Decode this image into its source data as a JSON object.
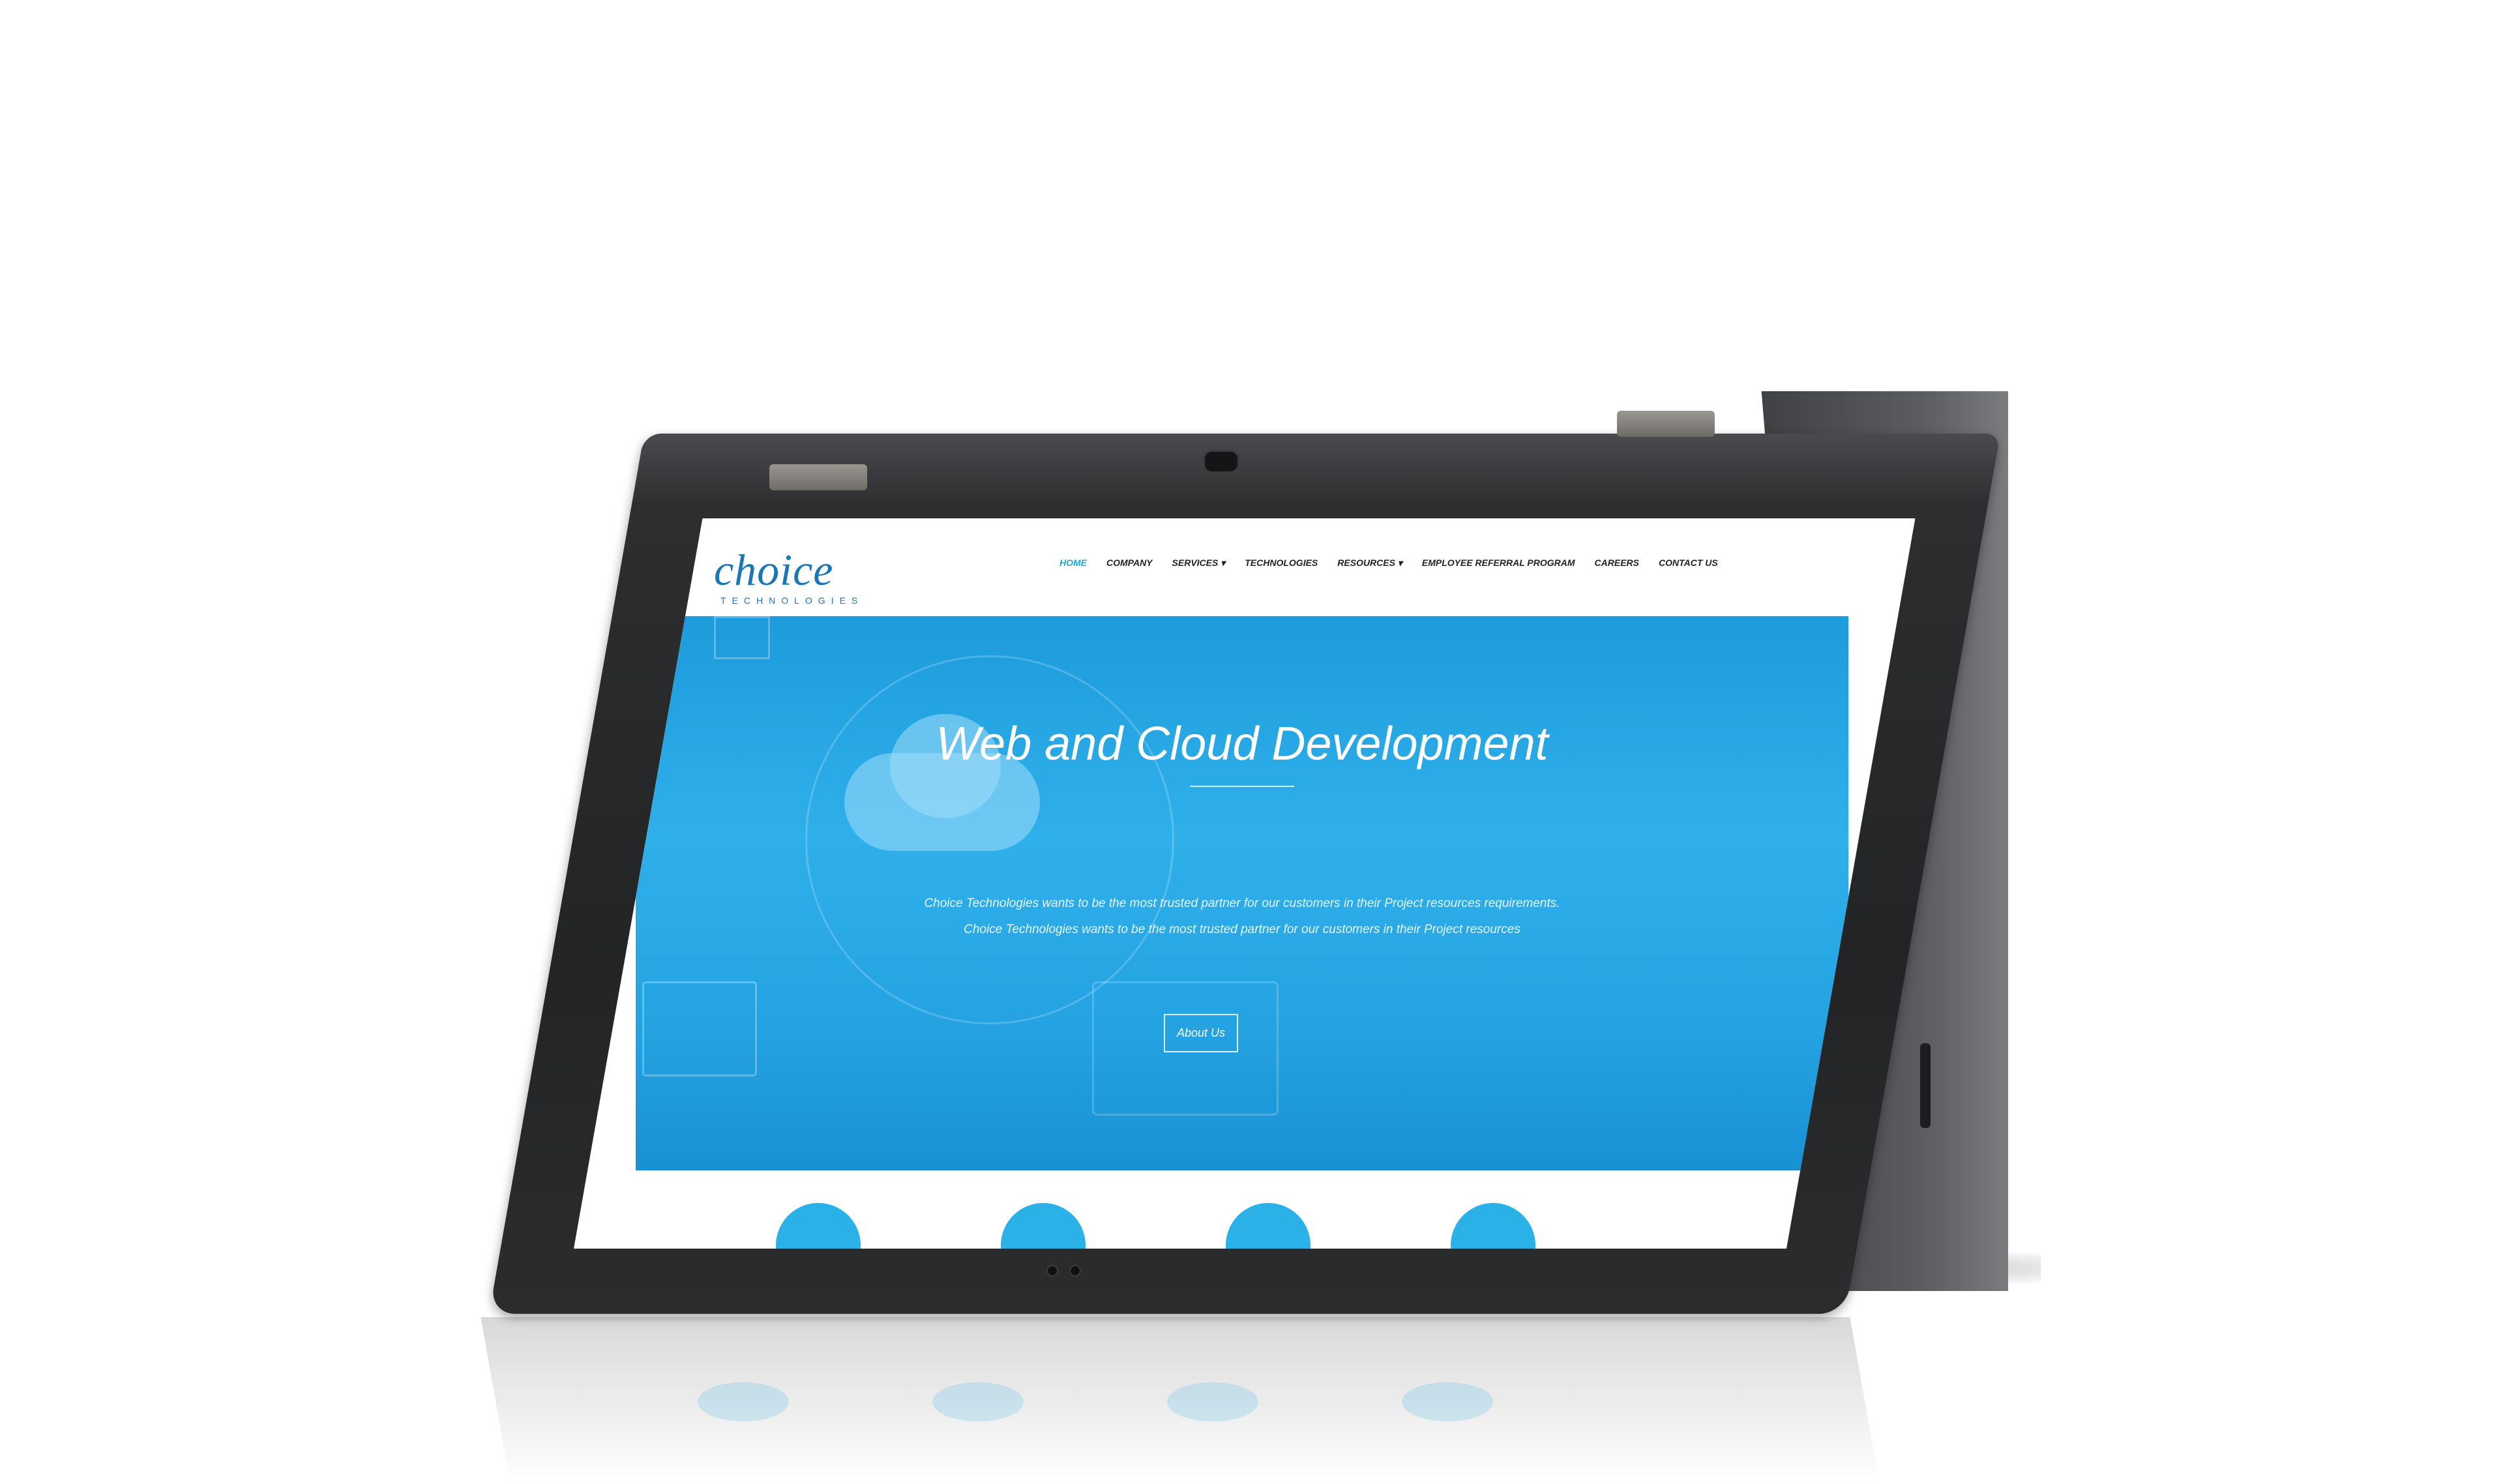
{
  "site": {
    "logo_text": "choice",
    "logo_subtext": "TECHNOLOGIES",
    "nav": [
      {
        "label": "HOME",
        "active": true
      },
      {
        "label": "COMPANY",
        "active": false
      },
      {
        "label": "SERVICES ▾",
        "active": false
      },
      {
        "label": "TECHNOLOGIES",
        "active": false
      },
      {
        "label": "RESOURCES ▾",
        "active": false
      },
      {
        "label": "EMPLOYEE REFERRAL PROGRAM",
        "active": false
      },
      {
        "label": "CAREERS",
        "active": false
      },
      {
        "label": "CONTACT US",
        "active": false
      }
    ]
  },
  "hero": {
    "title": "Web and Cloud Development",
    "desc_line1": "Choice Technologies wants to be the most trusted partner for our customers in their Project resources requirements.",
    "desc_line2": "Choice Technologies wants to be the most trusted partner for our customers in their Project resources",
    "button_label": "About Us"
  },
  "colors": {
    "accent": "#1ea7e0",
    "brand": "#1976b8",
    "hero_blue": "#24a2e2"
  }
}
